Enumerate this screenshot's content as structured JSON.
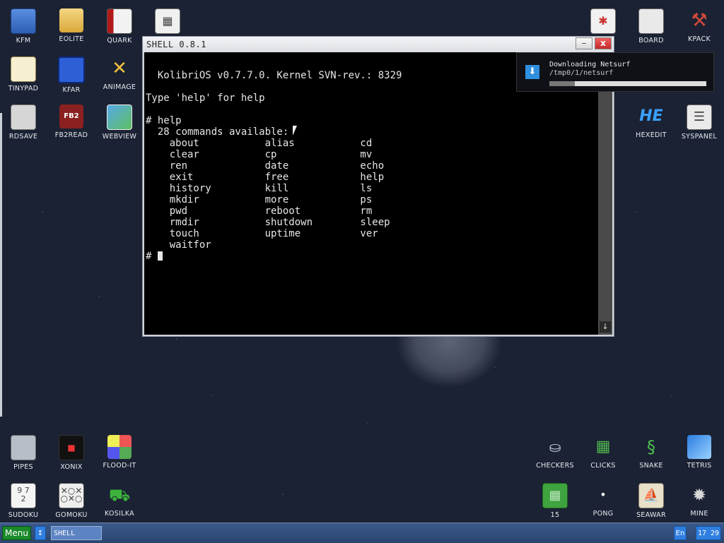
{
  "desktop": {
    "icons_top_left": [
      {
        "label": "KFM",
        "icon": "floppy-icon"
      },
      {
        "label": "EOLITE",
        "icon": "folder-icon"
      },
      {
        "label": "QUARK",
        "icon": "book-icon"
      },
      {
        "label": "CALC",
        "icon": "calculator-icon"
      },
      {
        "label": "TINYPAD",
        "icon": "notepad-icon"
      },
      {
        "label": "KFAR",
        "icon": "kfar-icon"
      },
      {
        "label": "ANIMAGE",
        "icon": "magic-wand-icon"
      },
      {
        "label": "RDSAVE",
        "icon": "rdsave-icon"
      },
      {
        "label": "FB2READ",
        "icon": "fb2-book-icon"
      },
      {
        "label": "WEBVIEW",
        "icon": "globe-icon"
      }
    ],
    "icons_top_right": [
      {
        "label": "BOARD",
        "icon": "board-icon"
      },
      {
        "label": "KPACK",
        "icon": "hammer-icon"
      },
      {
        "label": "HEXEDIT",
        "icon": "hex-edit-icon"
      },
      {
        "label": "SYSPANEL",
        "icon": "sliders-icon"
      }
    ],
    "icons_bottom_left": [
      {
        "label": "PIPES",
        "icon": "pipes-icon"
      },
      {
        "label": "XONIX",
        "icon": "xonix-icon"
      },
      {
        "label": "FLOOD-IT",
        "icon": "flood-icon"
      },
      {
        "label": "SUDOKU",
        "icon": "sudoku-icon"
      },
      {
        "label": "GOMOKU",
        "icon": "gomoku-icon"
      },
      {
        "label": "KOSILKA",
        "icon": "lawnmower-icon"
      }
    ],
    "icons_bottom_right": [
      {
        "label": "CHECKERS",
        "icon": "checkers-icon"
      },
      {
        "label": "CLICKS",
        "icon": "clicks-icon"
      },
      {
        "label": "SNAKE",
        "icon": "snake-icon"
      },
      {
        "label": "TETRIS",
        "icon": "tetris-icon"
      },
      {
        "label": "15",
        "icon": "fifteen-puzzle-icon"
      },
      {
        "label": "PONG",
        "icon": "pong-icon"
      },
      {
        "label": "SEAWAR",
        "icon": "ship-icon"
      },
      {
        "label": "MINE",
        "icon": "mine-icon"
      }
    ]
  },
  "shell_window": {
    "title": "SHELL 0.8.1",
    "minimize_glyph": "–",
    "close_glyph": "x",
    "lines": [
      "",
      "  KolibriOS v0.7.7.0. Kernel SVN-rev.: 8329",
      "",
      "Type 'help' for help",
      "",
      "# help",
      "  28 commands available:",
      "    about           alias           cd",
      "    clear           cp              mv",
      "    ren             date            echo",
      "    exit            free            help",
      "    history         kill            ls",
      "    mkdir           more            ps",
      "    pwd             reboot          rm",
      "    rmdir           shutdown        sleep",
      "    touch           uptime          ver",
      "    waitfor"
    ],
    "prompt": "# ",
    "scroll_arrow": "↓"
  },
  "notification": {
    "title": "Downloading Netsurf",
    "path": "/tmp0/1/netsurf",
    "progress": 0.16,
    "icon": "download-icon"
  },
  "taskbar": {
    "menu_label": "Menu",
    "switch_glyph": "↕",
    "task_label": "SHELL",
    "lang": "En",
    "time": "17 29"
  },
  "colors": {
    "menu_green": "#1a8a2a",
    "taskbar_blue": "#3b5a8a",
    "close_red": "#c42a2a"
  }
}
